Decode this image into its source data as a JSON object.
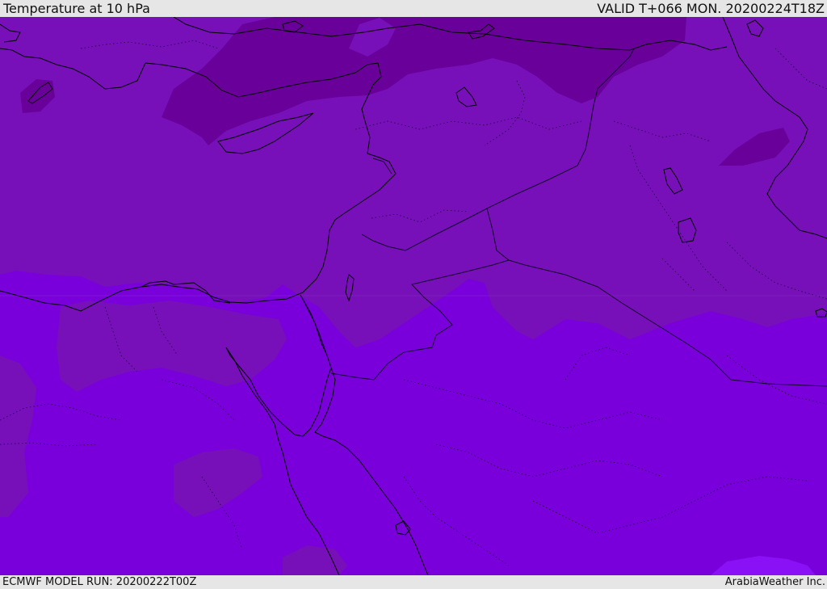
{
  "header": {
    "title": "Temperature at 10 hPa",
    "valid_time": "VALID T+066 MON. 20200224T18Z"
  },
  "footer": {
    "model_run": "ECMWF MODEL RUN: 20200222T00Z",
    "credit": "ArabiaWeather Inc."
  },
  "map": {
    "colors": {
      "band_cold": "#6a009a",
      "band_mid": "#7710b8",
      "band_warm": "#7a00db",
      "band_warmest": "#8a10f5",
      "coastline": "#000000",
      "borders": "#1a0030"
    }
  }
}
